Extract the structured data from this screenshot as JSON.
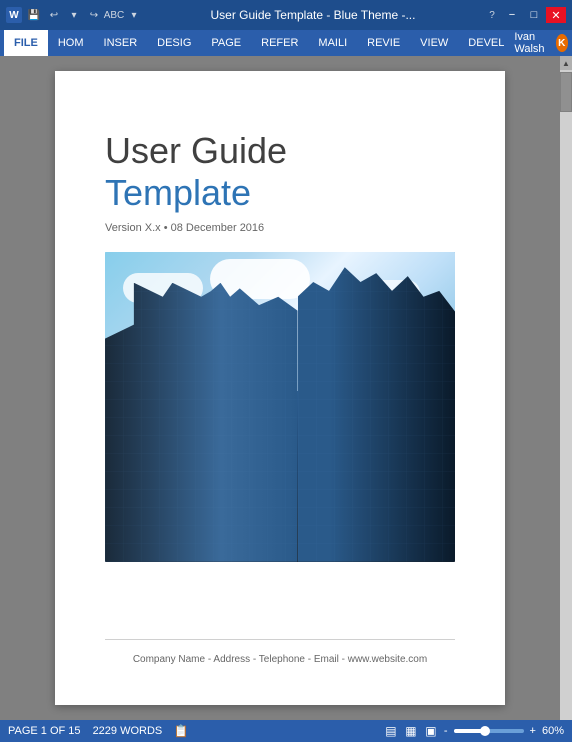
{
  "titlebar": {
    "title": "User Guide Template - Blue Theme -...",
    "help_btn": "?",
    "minimize_btn": "−",
    "maximize_btn": "□",
    "close_btn": "✕"
  },
  "ribbon": {
    "tabs": [
      "FILE",
      "HOM",
      "INSER",
      "DESIG",
      "PAGE",
      "REFER",
      "MAILI",
      "REVIE",
      "VIEW",
      "DEVEL"
    ],
    "active_tab": "FILE",
    "user": "Ivan Walsh",
    "user_initial": "K"
  },
  "document": {
    "title_line1": "User Guide",
    "title_line2": "Template",
    "version": "Version X.x • 08 December 2016",
    "footer": "Company Name - Address - Telephone - Email - www.website.com"
  },
  "statusbar": {
    "page_info": "PAGE 1 OF 15",
    "words": "2229 WORDS",
    "zoom": "60%",
    "plus_btn": "+",
    "minus_btn": "-"
  },
  "colors": {
    "ribbon_blue": "#2b5eab",
    "title_blue": "#2e74b5",
    "dark_text": "#404040"
  }
}
